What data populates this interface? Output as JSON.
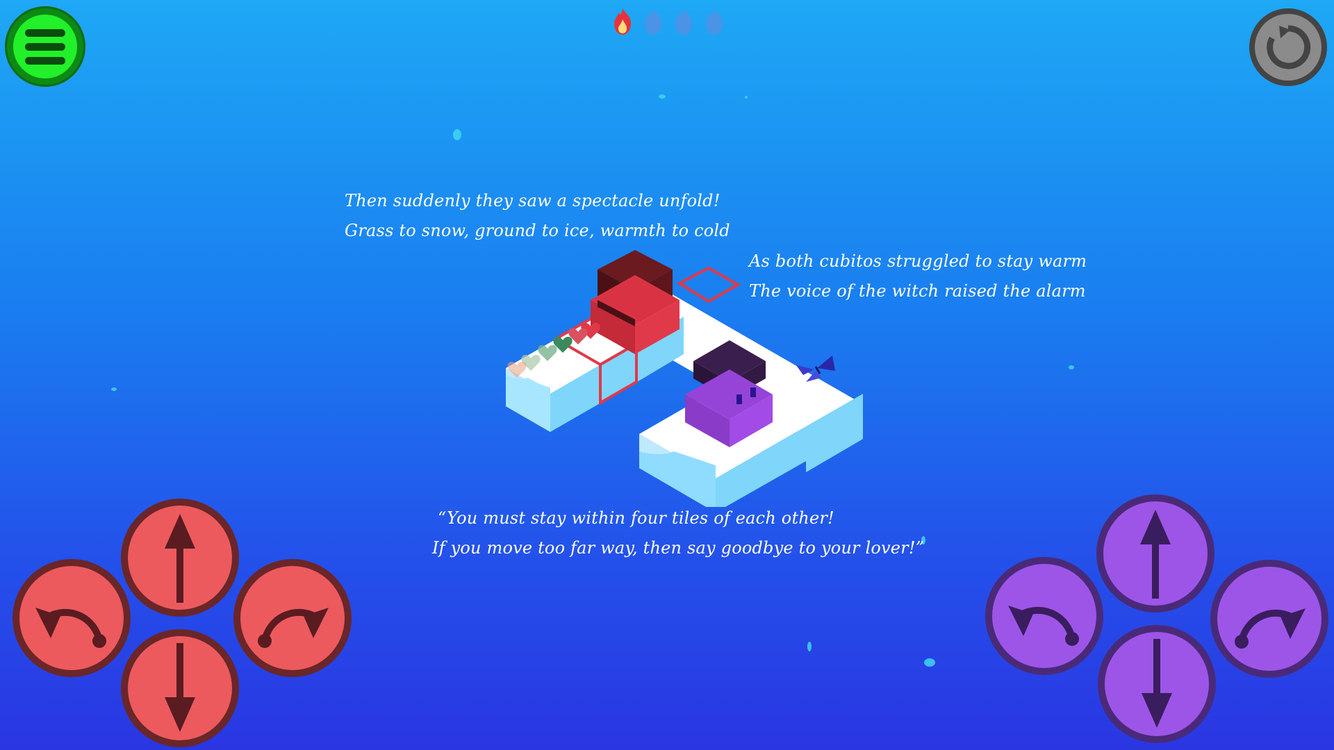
{
  "hud": {
    "menu_icon": "hamburger-menu-icon",
    "restart_icon": "restart-icon",
    "flames": [
      {
        "state": "lit",
        "color": "#e8323a"
      },
      {
        "state": "unlit",
        "color": "#5a8de0"
      },
      {
        "state": "unlit",
        "color": "#5a8de0"
      },
      {
        "state": "unlit",
        "color": "#5a8de0"
      }
    ]
  },
  "story": {
    "verse1": [
      "Then suddenly they saw a spectacle unfold!",
      "Grass to snow, ground to ice, warmth to cold"
    ],
    "verse2": [
      "As both cubitos struggled to stay warm",
      "The voice of the witch raised the alarm"
    ],
    "verse3": [
      "“You must stay within four tiles of each other!",
      "If you move too far way, then say goodbye to your lover!”"
    ]
  },
  "controls": {
    "red_player": {
      "color": "#ec5a5e",
      "buttons": [
        "rotate-left",
        "up",
        "rotate-right",
        "down"
      ]
    },
    "purple_player": {
      "color": "#9d55e8",
      "buttons": [
        "rotate-left",
        "up",
        "rotate-right",
        "down"
      ]
    }
  },
  "colors": {
    "sky_top": "#1ea8f5",
    "sky_bottom": "#2a36e2",
    "menu_green": "#22f02a",
    "red_cube": "#e0394a",
    "purple_cube": "#a24be6"
  }
}
